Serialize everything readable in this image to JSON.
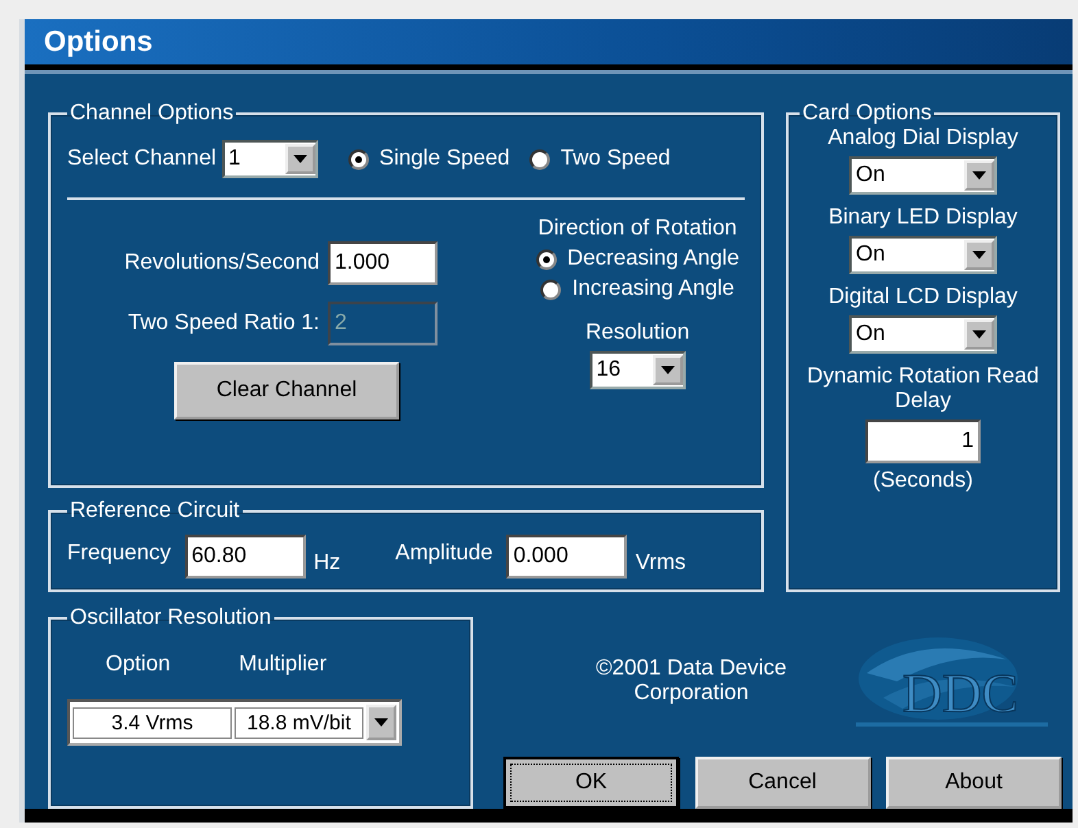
{
  "window": {
    "title": "Options"
  },
  "channel_options": {
    "title": "Channel Options",
    "select_channel": {
      "label": "Select Channel",
      "value": "1"
    },
    "speed_modes": [
      {
        "label": "Single Speed",
        "selected": true
      },
      {
        "label": "Two Speed",
        "selected": false
      }
    ],
    "revolutions": {
      "label": "Revolutions/Second",
      "value": "1.000"
    },
    "ratio": {
      "label": "Two Speed Ratio 1:",
      "value": "2",
      "disabled": true
    },
    "clear_button": "Clear Channel",
    "direction": {
      "label": "Direction of Rotation",
      "options": [
        {
          "label": "Decreasing Angle",
          "selected": true
        },
        {
          "label": "Increasing Angle",
          "selected": false
        }
      ]
    },
    "resolution": {
      "label": "Resolution",
      "value": "16"
    }
  },
  "reference_circuit": {
    "title": "Reference Circuit",
    "frequency": {
      "label": "Frequency",
      "value": "60.80",
      "unit": "Hz"
    },
    "amplitude": {
      "label": "Amplitude",
      "value": "0.000",
      "unit": "Vrms"
    }
  },
  "oscillator_resolution": {
    "title": "Oscillator Resolution",
    "columns": [
      "Option",
      "Multiplier"
    ],
    "option": "3.4 Vrms",
    "multiplier": "18.8 mV/bit"
  },
  "card_options": {
    "title": "Card Options",
    "displays": [
      {
        "label": "Analog Dial Display",
        "value": "On"
      },
      {
        "label": "Binary LED Display",
        "value": "On"
      },
      {
        "label": "Digital LCD Display",
        "value": "On"
      }
    ],
    "read_delay": {
      "label": "Dynamic Rotation Read Delay",
      "value": "1",
      "unit": "(Seconds)"
    }
  },
  "copyright": "©2001 Data Device Corporation",
  "logo": {
    "text": "DDC"
  },
  "buttons": [
    {
      "label": "OK",
      "focused": true
    },
    {
      "label": "Cancel",
      "focused": false
    },
    {
      "label": "About",
      "focused": false
    }
  ]
}
